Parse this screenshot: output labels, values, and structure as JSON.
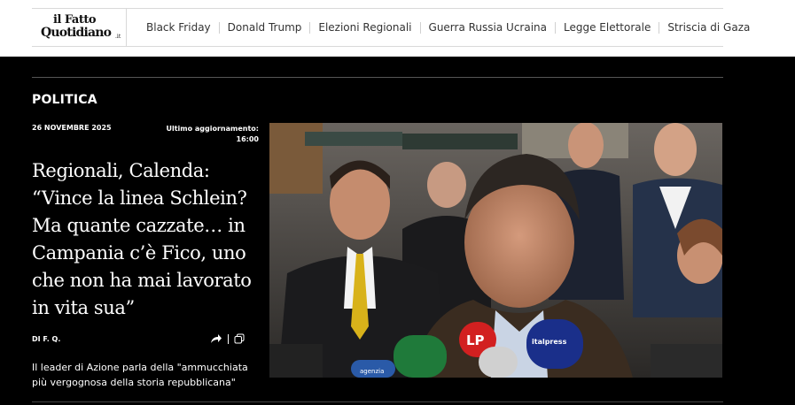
{
  "header": {
    "logo": {
      "line1": "il Fatto",
      "line2": "Quotidiano",
      "suffix": ".it"
    },
    "nav": [
      {
        "label": "Black Friday"
      },
      {
        "label": "Donald Trump"
      },
      {
        "label": "Elezioni Regionali"
      },
      {
        "label": "Guerra Russia Ucraina"
      },
      {
        "label": "Legge Elettorale"
      },
      {
        "label": "Striscia di Gaza"
      }
    ]
  },
  "article": {
    "section": "POLITICA",
    "date": "26 NOVEMBRE 2025",
    "updated_label": "Ultimo aggiornamento:",
    "updated_time": "16:00",
    "headline_lines": [
      "Regionali, Calenda:",
      "“Vince la linea Schlein?",
      "Ma quante cazzate… in",
      "Campania c’è Fico, uno",
      "che non ha mai lavorato",
      "in vita sua”"
    ],
    "author": "DI F. Q.",
    "subtitle": "Il leader di Azione parla della \"ammucchiata più vergognosa della storia repubblicana\""
  },
  "photo": {
    "mic_labels": [
      "LP",
      "italpress",
      "agenzia"
    ]
  }
}
